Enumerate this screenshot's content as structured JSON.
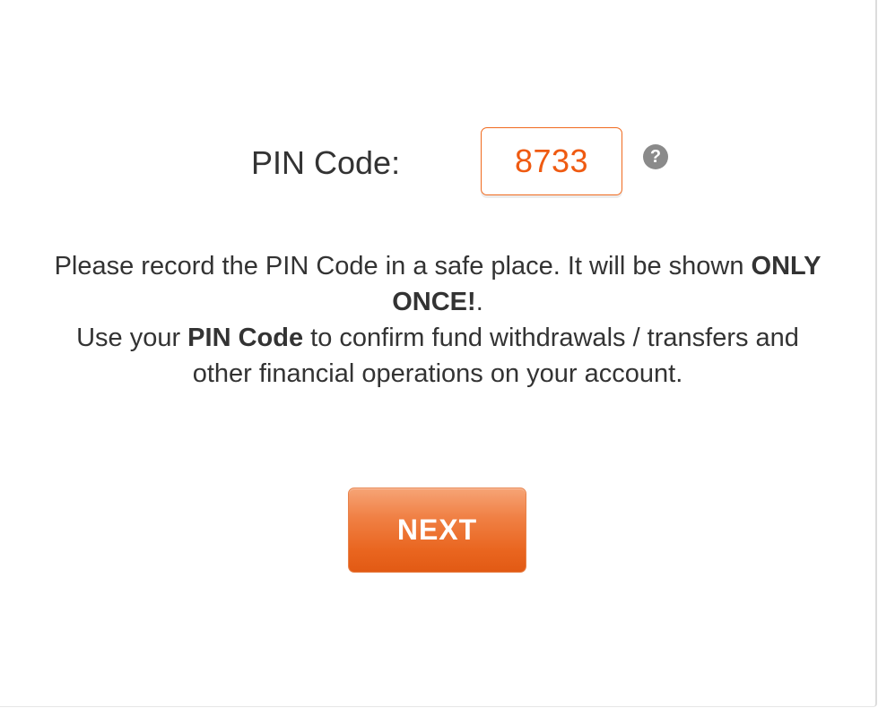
{
  "pin": {
    "label": "PIN Code:",
    "value": "8733",
    "help_icon": "question-circle-icon",
    "help_glyph": "?"
  },
  "message": {
    "line1_part1": "Please record the PIN Code in a safe place. It will be shown ",
    "line1_bold": "ONLY ONCE!",
    "line1_end": ".",
    "line2_part1": "Use your ",
    "line2_bold": "PIN Code",
    "line2_part2": " to confirm fund withdrawals / transfers and other financial operations on your account."
  },
  "actions": {
    "next_label": "NEXT"
  },
  "colors": {
    "accent": "#ef5a11",
    "button_gradient_top": "#f6a476",
    "button_gradient_bottom": "#e25a14",
    "help_icon_bg": "#8a8a8a",
    "text": "#333333"
  }
}
